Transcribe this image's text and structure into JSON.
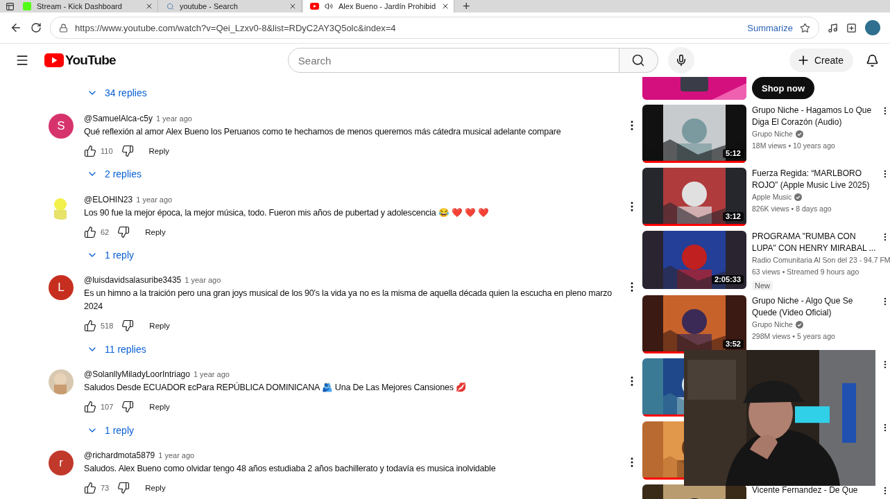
{
  "browser": {
    "tabs": [
      {
        "title": "Stream - Kick Dashboard",
        "selected": false,
        "kind": "kick",
        "audio": false
      },
      {
        "title": "youtube - Search",
        "selected": false,
        "kind": "search",
        "audio": false
      },
      {
        "title": "Alex Bueno - Jardín Prohibid",
        "selected": true,
        "kind": "youtube",
        "audio": true
      }
    ],
    "new_tab": "+",
    "url": "https://www.youtube.com/watch?v=Qei_Lzxv0-8&list=RDyC2AY3Q5olc&index=4",
    "summarize": "Summarize"
  },
  "header": {
    "logo": "YouTube",
    "search": {
      "placeholder": "Search"
    },
    "create": "Create"
  },
  "comments": {
    "top_replies": "34 replies",
    "items": [
      {
        "avatar": {
          "kind": "letter",
          "letter": "S",
          "color": "#d6336c"
        },
        "author": "@SamuelAlca-c5y",
        "time": "1 year ago",
        "text": "Qué reflexión al amor Alex Bueno los Peruanos como te hechamos de menos queremos más cátedra musical adelante compare",
        "likes": "110",
        "reply": "Reply",
        "replies": "2 replies"
      },
      {
        "author": "@ELOHIN23",
        "time": "1 year ago",
        "text": "Los 90 fue la mejor época, la mejor música, todo. Fueron mis años de pubertad y adolescencia 😂 ❤️ ❤️ ❤️",
        "likes": "62",
        "reply": "Reply",
        "replies": "1 reply"
      },
      {
        "avatar": {
          "kind": "letter",
          "letter": "L",
          "color": "#c62f1f"
        },
        "author": "@luisdavidsalasuribe3435",
        "time": "1 year ago",
        "text": "Es un himno a la traición pero una gran joys musical de los 90's  la vida ya no es la misma de aquella década quien la escucha en pleno marzo 2024",
        "likes": "518",
        "reply": "Reply",
        "replies": "11 replies"
      },
      {
        "author": "@SolanllyMiladyLoorIntriago",
        "time": "1 year ago",
        "text": "Saludos Desde ECUADOR ᴇᴄPara REPÚBLICA DOMINICANA 🫂 Una De Las Mejores Cansiones 💋",
        "likes": "107",
        "reply": "Reply",
        "replies": "1 reply"
      },
      {
        "avatar": {
          "kind": "letter",
          "letter": "r",
          "color": "#c0392b"
        },
        "author": "@richardmota5879",
        "time": "1 year ago",
        "text": "Saludos. Alex Bueno como olvidar tengo 48 años estudiaba 2 años bachillerato y todavía es musica inolvidable",
        "likes": "73",
        "reply": "Reply"
      }
    ]
  },
  "sidebar": {
    "ad": {
      "button": "Shop now"
    },
    "videos": [
      {
        "kind": "full",
        "title": "Grupo Niche - Hagamos Lo Que Diga El Corazón (Audio)",
        "channel": "Grupo Niche",
        "verified": true,
        "meta": "18M views • 10 years ago",
        "duration": "5:12",
        "watched": true
      },
      {
        "kind": "full",
        "title": "Fuerza Regida: “MARLBORO ROJO” (Apple Music Live 2025)",
        "channel": "Apple Music",
        "verified": true,
        "meta": "826K views • 8 days ago",
        "duration": "3:12",
        "watched": true
      },
      {
        "kind": "full",
        "title": "PROGRAMA \"RUMBA CON LUPA\" CON HENRY MIRABAL ...",
        "channel": "Radio Comunitaria Al Son del 23 - 94.7 FM",
        "verified": false,
        "meta": "63 views • Streamed 9 hours ago",
        "duration": "2:05:33",
        "badge": "New",
        "watched": false
      },
      {
        "kind": "full",
        "title": "Grupo Niche - Algo Que Se Quede (Video Oficial)",
        "channel": "Grupo Niche",
        "verified": true,
        "meta": "298M views • 5 years ago",
        "duration": "3:52",
        "watched": true
      },
      {
        "kind": "covered",
        "watched": true
      },
      {
        "kind": "covered",
        "watched": true
      },
      {
        "kind": "cut",
        "title": "Vicente Fernandez - De Que"
      }
    ]
  }
}
